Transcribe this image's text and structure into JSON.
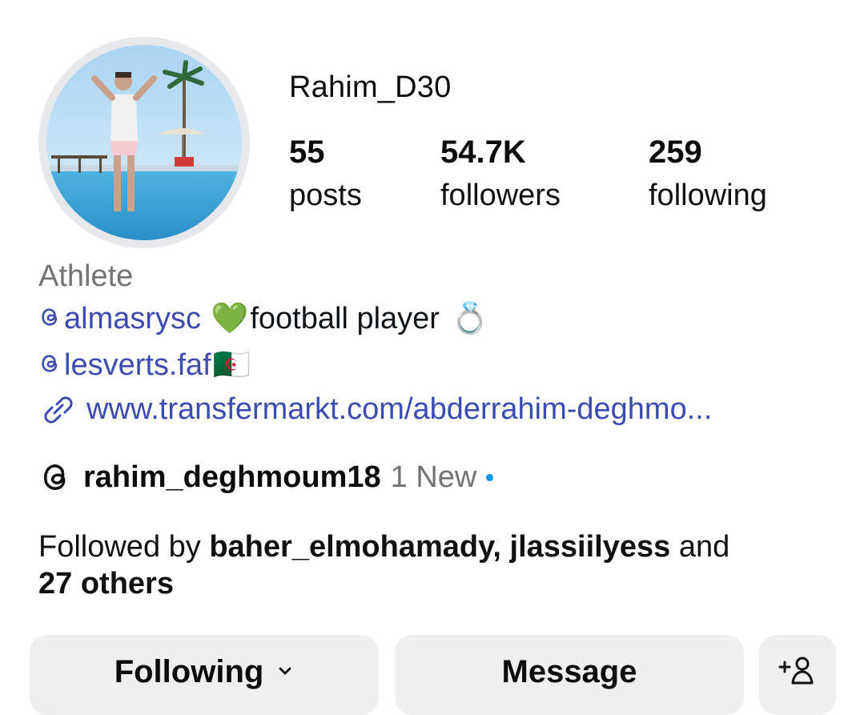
{
  "profile": {
    "username": "Rahim_D30",
    "category": "Athlete",
    "avatar": "profile-photo"
  },
  "stats": {
    "posts": {
      "value": "55",
      "label": "posts"
    },
    "followers": {
      "value": "54.7K",
      "label": "followers"
    },
    "following": {
      "value": "259",
      "label": "following"
    }
  },
  "bio": {
    "mention1": "almasrysc",
    "text1": "football player",
    "mention2": "lesverts.faf",
    "link": "www.transfermarkt.com/abderrahim-deghmo...",
    "emoji_heart": "💚",
    "emoji_ring": "💍",
    "emoji_flag": "🇩🇿"
  },
  "threads": {
    "handle": "rahim_deghmoum18",
    "badge": "1 New",
    "dot_color": "#0095f6"
  },
  "followed_by": {
    "prefix": "Followed by ",
    "names": "baher_elmohamady, jlassiilyess",
    "middle": " and",
    "others": "27 others"
  },
  "actions": {
    "following_label": "Following",
    "message_label": "Message",
    "add_user_icon": "add-person-icon"
  },
  "colors": {
    "link": "#3c4bb2",
    "muted": "#737373",
    "button_bg": "#efeff0"
  }
}
